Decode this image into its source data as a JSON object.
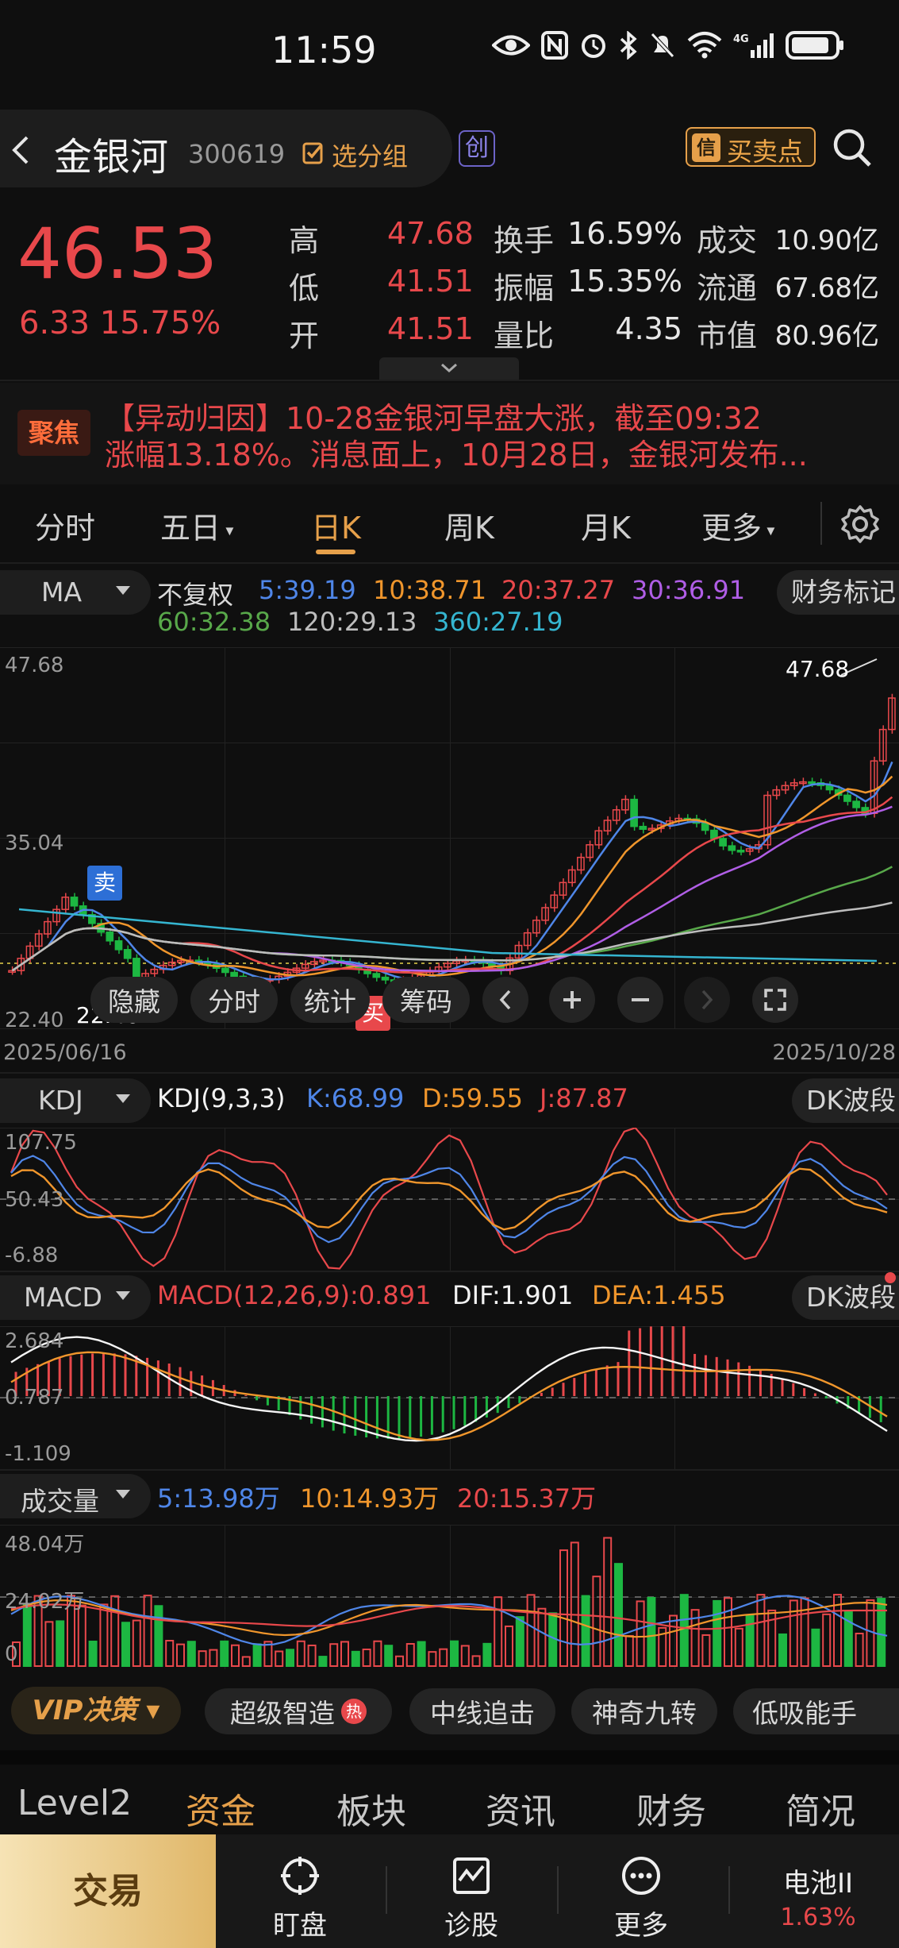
{
  "status": {
    "time": "11:59"
  },
  "stock": {
    "name": "金银河",
    "code": "300619",
    "group_label": "选分组",
    "board_badge": "创",
    "buy_sell_label": "买卖点",
    "buy_sell_icon": "信",
    "price": "46.53",
    "change": "6.33 15.75%",
    "quotes": [
      {
        "label": "高",
        "value": "47.68",
        "color": "red"
      },
      {
        "label": "低",
        "value": "41.51",
        "color": "red"
      },
      {
        "label": "开",
        "value": "41.51",
        "color": "red"
      }
    ],
    "stats": [
      {
        "label": "换手",
        "value": "16.59%"
      },
      {
        "label": "振幅",
        "value": "15.35%"
      },
      {
        "label": "量比",
        "value": "4.35"
      }
    ],
    "stats2": [
      {
        "label": "成交",
        "value": "10.90亿"
      },
      {
        "label": "流通",
        "value": "67.68亿"
      },
      {
        "label": "市值",
        "value": "80.96亿"
      }
    ]
  },
  "news": {
    "badge": "聚焦",
    "line1": "【异动归因】10-28金银河早盘大涨，截至09:32",
    "line2": "涨幅13.18%。消息面上，10月28日，金银河发布..."
  },
  "tabs": {
    "items": [
      "分时",
      "五日",
      "日K",
      "周K",
      "月K",
      "更多"
    ],
    "active": "日K"
  },
  "ma_bar": {
    "selector": "MA",
    "adjust": "不复权",
    "ma5": "5:39.19",
    "ma10": "10:38.71",
    "ma20": "20:37.27",
    "ma30": "30:36.91",
    "ma60": "60:32.38",
    "ma120": "120:29.13",
    "ma360": "360:27.19",
    "finance_btn": "财务标记"
  },
  "kchart": {
    "y_top": "47.68",
    "y_mid": "35.04",
    "y_bottom": "22.40",
    "high_label": "47.68",
    "low_label": "22.40",
    "date_start": "2025/06/16",
    "date_end": "2025/10/28",
    "sell_marker": "卖",
    "buy_marker": "买",
    "toolbar": [
      "隐藏",
      "分时",
      "统计",
      "筹码"
    ]
  },
  "kdj": {
    "selector": "KDJ",
    "params": "KDJ(9,3,3)",
    "k": "K:68.99",
    "d": "D:59.55",
    "j": "J:87.87",
    "dk_btn": "DK波段",
    "y_top": "107.75",
    "y_mid": "50.43",
    "y_bottom": "-6.88"
  },
  "macd": {
    "selector": "MACD",
    "params": "MACD(12,26,9):0.891",
    "dif": "DIF:1.901",
    "dea": "DEA:1.455",
    "dk_btn": "DK波段",
    "y_top": "2.684",
    "y_mid": "0.787",
    "y_bottom": "-1.109"
  },
  "volume": {
    "selector": "成交量",
    "v5": "5:13.98万",
    "v10": "10:14.93万",
    "v20": "20:15.37万",
    "y_top": "48.04万",
    "y_mid": "24.02万",
    "y_bottom": "0"
  },
  "strategy": {
    "vip": "VIP决策",
    "items": [
      "超级智造",
      "中线追击",
      "神奇九转",
      "低吸能手"
    ],
    "hot_badge": "热"
  },
  "bottom_tabs": [
    "Level2",
    "资金",
    "板块",
    "资讯",
    "财务",
    "简况"
  ],
  "bottom_tabs_active": "资金",
  "footer": {
    "trade": "交易",
    "items": [
      "盯盘",
      "诊股",
      "更多"
    ],
    "battery_label": "电池II",
    "battery_pct": "1.63%"
  },
  "colors": {
    "up": "#e8484b",
    "down": "#1db742",
    "accent": "#e6a04a",
    "ma5": "#4f86e8",
    "ma10": "#f0962c",
    "ma20": "#e8484b",
    "ma30": "#b05ee6",
    "ma60": "#58a84a",
    "ma120": "#bdbdbd",
    "ma360": "#35b5d0"
  }
}
